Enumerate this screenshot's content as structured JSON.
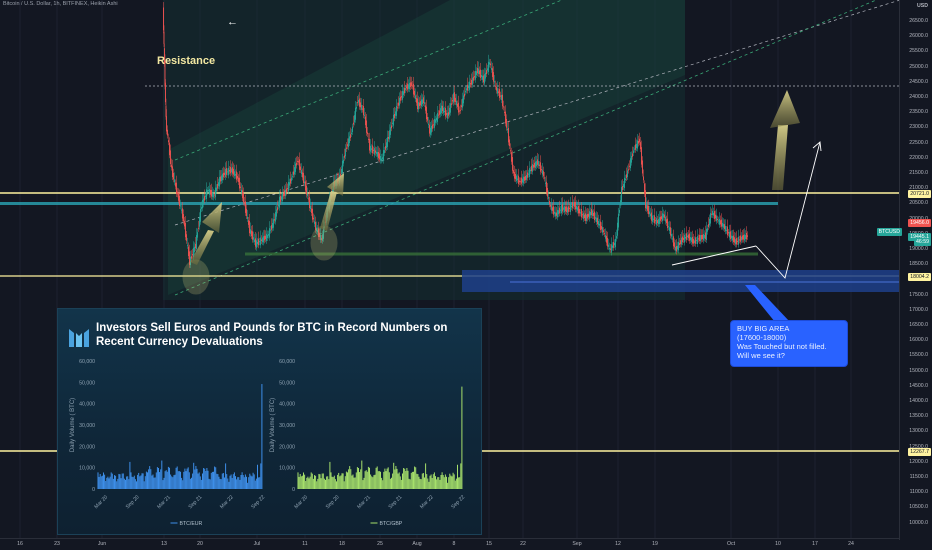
{
  "header": {
    "symbol": "Bitcoin / U.S. Dollar, 1h, BITFINEX, Heikin Ashi"
  },
  "annotations": {
    "resistance": "Resistance",
    "back_arrow": "←"
  },
  "price_axis": {
    "currency": "USD",
    "ticks": [
      "26500.0",
      "26000.0",
      "25500.0",
      "25000.0",
      "24500.0",
      "24000.0",
      "23500.0",
      "23000.0",
      "22500.0",
      "22000.0",
      "21500.0",
      "21000.0",
      "20500.0",
      "20000.0",
      "19500.0",
      "19000.0",
      "18500.0",
      "18000.0",
      "17500.0",
      "17000.0",
      "16500.0",
      "16000.0",
      "15500.0",
      "15000.0",
      "14500.0",
      "14000.0",
      "13500.0",
      "13000.0",
      "12500.0",
      "12000.0",
      "11500.0",
      "11000.0",
      "10500.0",
      "10000.0"
    ],
    "labels": [
      {
        "text": "20721.0",
        "bg": "#fff3a0",
        "fg": "#131722"
      },
      {
        "text": "19456.0",
        "bg": "#ef5350",
        "fg": "#ffffff"
      },
      {
        "text": "BTCUSD",
        "bg": "#26a69a",
        "fg": "#ffffff"
      },
      {
        "text": "19445.1",
        "bg": "#26a69a",
        "fg": "#ffffff"
      },
      {
        "text": "46:59",
        "bg": "#26a69a",
        "fg": "#ffffff"
      },
      {
        "text": "18004.2",
        "bg": "#fff3a0",
        "fg": "#131722"
      },
      {
        "text": "12267.7",
        "bg": "#fff3a0",
        "fg": "#131722"
      }
    ]
  },
  "time_axis": {
    "ticks": [
      "16",
      "23",
      "Jun",
      "13",
      "20",
      "Jul",
      "11",
      "18",
      "25",
      "Aug",
      "8",
      "15",
      "22",
      "Sep",
      "12",
      "19",
      "Oct",
      "10",
      "17",
      "24"
    ]
  },
  "callout": {
    "line1": "BUY BIG AREA",
    "line2": "(17600-18000)",
    "line3": "Was Touched but not filled.",
    "line4": "Will we see it?"
  },
  "inset": {
    "title_line1": "Investors Sell Euros and Pounds for BTC in Record Numbers on",
    "title_line2": "Recent Currency Devaluations",
    "charts": [
      {
        "series": "BTC/EUR",
        "ylabel": "Daily Volume ( BTC)",
        "color": "#3d8ee8"
      },
      {
        "series": "BTC/GBP",
        "ylabel": "Daily Volume ( BTC)",
        "color": "#a6e06b"
      }
    ],
    "yticks": [
      "60,000",
      "50,000",
      "40,000",
      "30,000",
      "20,000",
      "10,000",
      "0"
    ],
    "xticks": [
      "Mar 20",
      "Sep 20",
      "Mar 21",
      "Sep 21",
      "Mar 22",
      "Sep 22"
    ]
  },
  "colors": {
    "bg": "#131722",
    "up": "#26a69a",
    "down": "#ef5350",
    "level": "#fff3a0",
    "zone": "#1e3f8a",
    "arrow": "#c9c47a"
  }
}
